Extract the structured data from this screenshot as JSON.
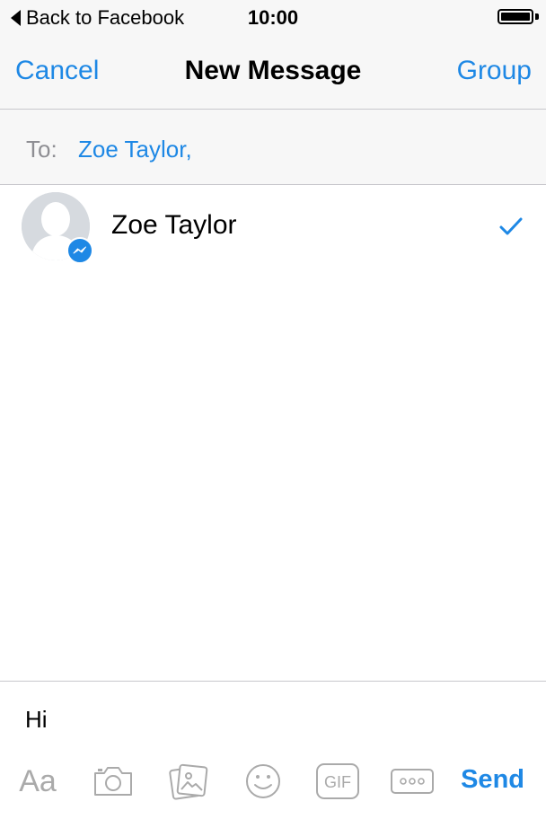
{
  "status_bar": {
    "back_label": "Back to Facebook",
    "time": "10:00",
    "battery_icon": "battery-full-icon"
  },
  "nav": {
    "cancel_label": "Cancel",
    "title": "New Message",
    "group_label": "Group"
  },
  "to_field": {
    "label": "To:",
    "value": "Zoe Taylor,"
  },
  "contacts": [
    {
      "name": "Zoe Taylor",
      "selected": true,
      "badge_icon": "messenger-badge-icon"
    }
  ],
  "composer": {
    "text": "Hi",
    "tools": [
      {
        "name": "text-format-button",
        "label": "Aa"
      },
      {
        "name": "camera-icon"
      },
      {
        "name": "photo-gallery-icon"
      },
      {
        "name": "emoji-icon"
      },
      {
        "name": "gif-icon",
        "label": "GIF"
      },
      {
        "name": "more-icon"
      }
    ],
    "send_label": "Send"
  },
  "colors": {
    "accent": "#1e88e5",
    "bar_background": "#f7f7f7",
    "divider": "#c8c7cc",
    "muted_icon": "#aaaaaa",
    "muted_text": "#8e8e93"
  }
}
